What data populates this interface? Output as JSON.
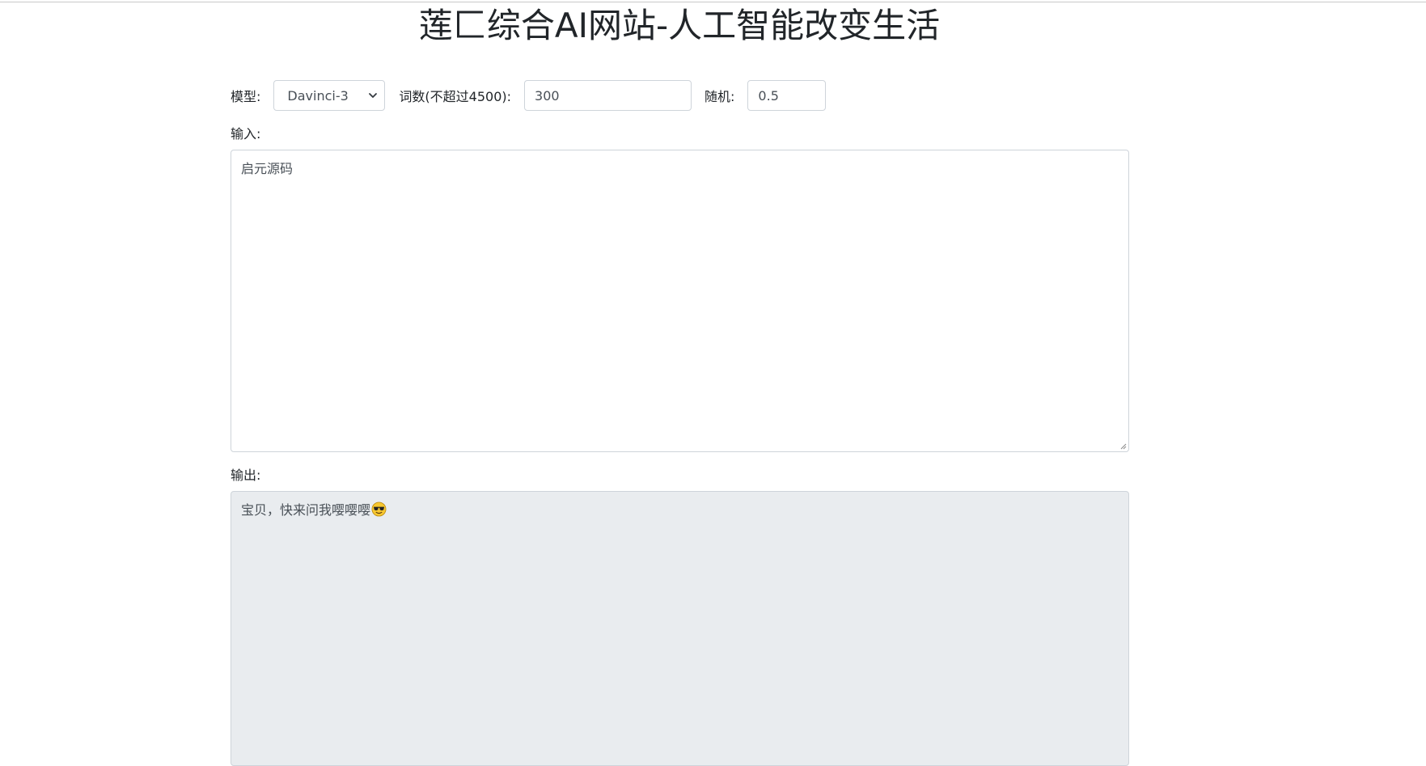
{
  "page": {
    "title": "莲匚综合AI网站-人工智能改变生活"
  },
  "controls": {
    "model_label": "模型:",
    "model_value": "Davinci-3",
    "words_label": "词数(不超过4500):",
    "words_value": "300",
    "random_label": "随机:",
    "random_value": "0.5"
  },
  "input": {
    "label": "输入:",
    "value": "启元源码"
  },
  "output": {
    "label": "输出:",
    "value": "宝贝，快来问我嘤嘤嘤",
    "emoji_icon": "sunglasses-face-icon"
  },
  "colors": {
    "border": "#ced4da",
    "readonly_bg": "#e9ecef",
    "text": "#212529",
    "field_text": "#495057"
  }
}
